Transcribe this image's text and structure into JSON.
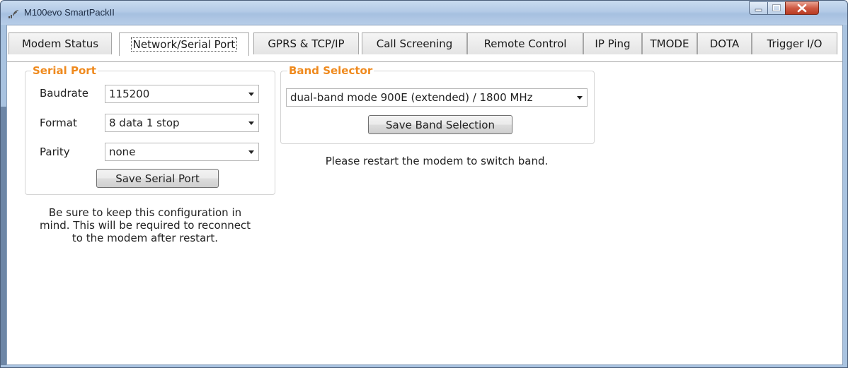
{
  "window": {
    "title": "M100evo SmartPackII",
    "controls": {
      "minimize_icon": "minimize-icon",
      "maximize_icon": "maximize-icon",
      "close_icon": "close-icon"
    }
  },
  "tabs": [
    {
      "label": "Modem Status",
      "active": false
    },
    {
      "label": "Network/Serial Port",
      "active": true
    },
    {
      "label": "GPRS & TCP/IP",
      "active": false
    },
    {
      "label": "Call Screening",
      "active": false
    },
    {
      "label": "Remote Control",
      "active": false
    },
    {
      "label": "IP Ping",
      "active": false
    },
    {
      "label": "TMODE",
      "active": false
    },
    {
      "label": "DOTA",
      "active": false
    },
    {
      "label": "Trigger I/O",
      "active": false
    }
  ],
  "serial_port": {
    "title": "Serial Port",
    "baudrate_label": "Baudrate",
    "baudrate_value": "115200",
    "format_label": "Format",
    "format_value": "8 data 1 stop",
    "parity_label": "Parity",
    "parity_value": "none",
    "save_label": "Save Serial Port",
    "note_line1": "Be sure to keep this configuration in",
    "note_line2": "mind. This will be required to reconnect",
    "note_line3": "to the modem after restart."
  },
  "band_selector": {
    "title": "Band Selector",
    "band_value": "dual-band mode 900E (extended) / 1800 MHz",
    "save_label": "Save Band Selection",
    "note": "Please restart the modem to switch band."
  },
  "colors": {
    "accent": "#ef8a1e",
    "close_button": "#c44a32"
  }
}
